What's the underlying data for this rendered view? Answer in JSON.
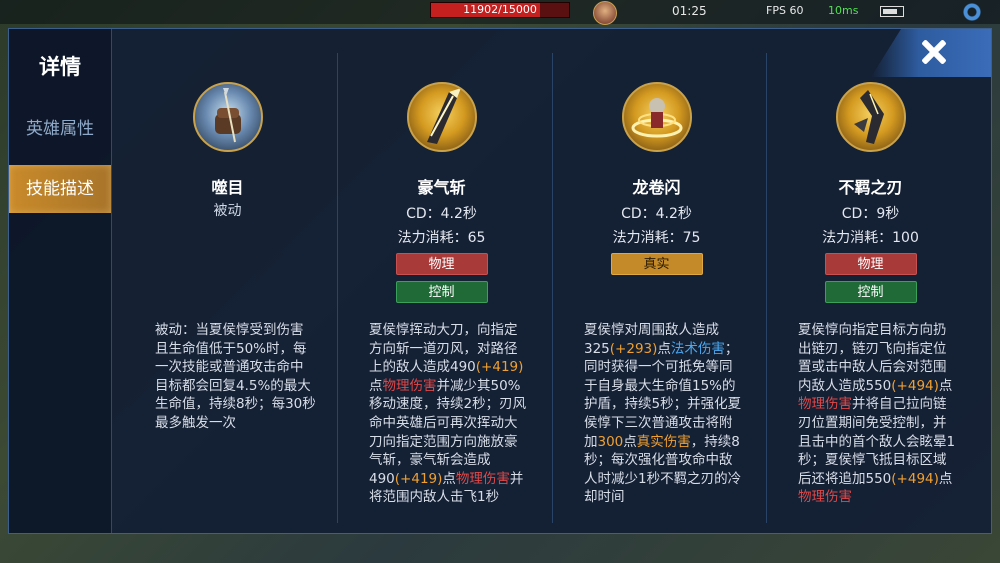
{
  "hud": {
    "hp_text": "11902/15000",
    "hp_fraction": 0.793,
    "timer": "01:25",
    "fps": "FPS 60",
    "ping": "10ms"
  },
  "panel": {
    "title": "详情",
    "tabs": [
      {
        "label": "英雄属性",
        "active": false
      },
      {
        "label": "技能描述",
        "active": true
      }
    ]
  },
  "skills": [
    {
      "name": "噬目",
      "type": "被动",
      "icon": "fist-icon",
      "description": "被动：当夏侯惇受到伤害且生命值低于50%时，每一次技能或普通攻击命中目标都会回复4.5%的最大生命值，持续8秒；每30秒最多触发一次"
    },
    {
      "name": "豪气斩",
      "cd": "CD：4.2秒",
      "cost": "法力消耗：65",
      "tags": [
        "物理",
        "控制"
      ],
      "icon": "blade-icon",
      "desc_parts": [
        {
          "t": "夏侯惇挥动大刀，向指定方向斩一道刃风，对路径上的敌人造成490"
        },
        {
          "t": "(+419)",
          "c": "orange"
        },
        {
          "t": "点"
        },
        {
          "t": "物理伤害",
          "c": "red"
        },
        {
          "t": "并减少其50%移动速度，持续2秒；刃风命中英雄后可再次挥动大刀向指定范围方向施放豪气斩，豪气斩会造成490"
        },
        {
          "t": "(+419)",
          "c": "orange"
        },
        {
          "t": "点"
        },
        {
          "t": "物理伤害",
          "c": "red"
        },
        {
          "t": "并将范围内敌人击飞1秒"
        }
      ]
    },
    {
      "name": "龙卷闪",
      "cd": "CD：4.2秒",
      "cost": "法力消耗：75",
      "tags": [
        "真实"
      ],
      "icon": "whirlwind-icon",
      "desc_parts": [
        {
          "t": "夏侯惇对周围敌人造成325"
        },
        {
          "t": "(+293)",
          "c": "orange"
        },
        {
          "t": "点"
        },
        {
          "t": "法术伤害",
          "c": "blue"
        },
        {
          "t": "；同时获得一个可抵免等同于自身最大生命值15%的护盾，持续5秒；并强化夏侯惇下三次普通攻击将附加"
        },
        {
          "t": "300",
          "c": "orange"
        },
        {
          "t": "点"
        },
        {
          "t": "真实伤害",
          "c": "orange"
        },
        {
          "t": "，持续8秒；每次强化普攻命中敌人时减少1秒不羁之刃的冷却时间"
        }
      ]
    },
    {
      "name": "不羁之刃",
      "cd": "CD：9秒",
      "cost": "法力消耗：100",
      "tags": [
        "物理",
        "控制"
      ],
      "icon": "chain-blade-icon",
      "desc_parts": [
        {
          "t": "夏侯惇向指定目标方向扔出链刃，链刃飞向指定位置或击中敌人后会对范围内敌人造成550"
        },
        {
          "t": "(+494)",
          "c": "orange"
        },
        {
          "t": "点"
        },
        {
          "t": "物理伤害",
          "c": "red"
        },
        {
          "t": "并将自己拉向链刃位置期间免受控制，并且击中的首个敌人会眩晕1秒；夏侯惇飞抵目标区域后还将追加550"
        },
        {
          "t": "(+494)",
          "c": "orange"
        },
        {
          "t": "点"
        },
        {
          "t": "物理伤害",
          "c": "red"
        }
      ]
    }
  ]
}
